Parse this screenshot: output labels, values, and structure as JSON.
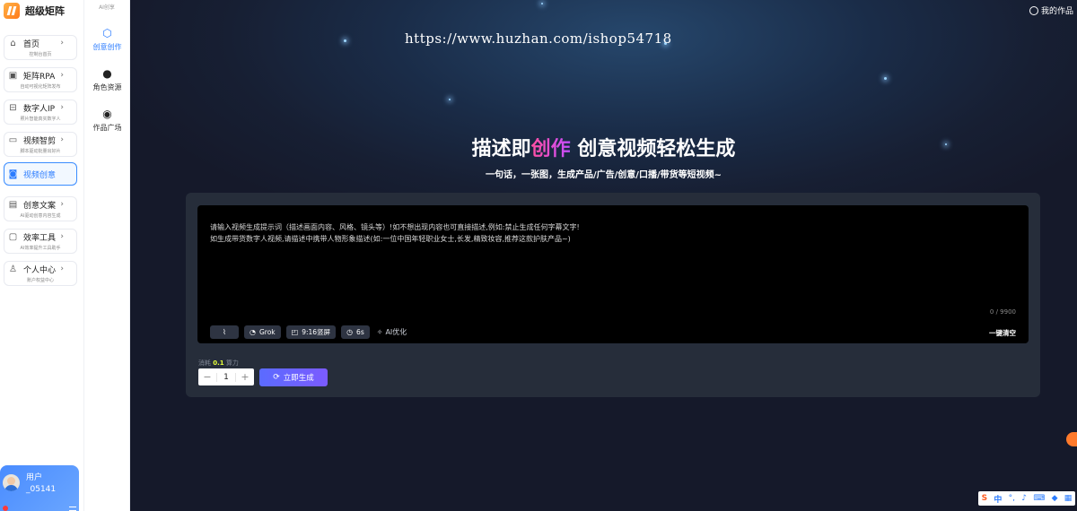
{
  "brand": {
    "name": "超级矩阵",
    "icon": "brand-logo-icon",
    "color": "#ff8a2b"
  },
  "sidebar": {
    "items": [
      {
        "label": "首页",
        "sub": "控制台首页",
        "icon": "home-icon"
      },
      {
        "label": "矩阵RPA",
        "sub": "自动可视化矩阵发布",
        "icon": "calendar-icon"
      },
      {
        "label": "数字人IP",
        "sub": "照片智能真实数字人",
        "icon": "lock-icon"
      },
      {
        "label": "视频智剪",
        "sub": "脚本驱动批量出好片",
        "icon": "video-icon"
      },
      {
        "label": "视频创意",
        "sub": "",
        "icon": "camera-icon",
        "active": true
      },
      {
        "label": "创意文案",
        "sub": "AI驱动创意内容生成",
        "icon": "monitor-icon"
      },
      {
        "label": "效率工具",
        "sub": "AI效率提升工具助手",
        "icon": "briefcase-icon"
      },
      {
        "label": "个人中心",
        "sub": "账户权益中心",
        "icon": "user-icon"
      }
    ]
  },
  "user": {
    "label": "用户",
    "id": "_05141"
  },
  "subnav": {
    "header": "AI创享",
    "items": [
      {
        "label": "创意创作",
        "icon": "creative-icon",
        "active": true
      },
      {
        "label": "角色资源",
        "icon": "people-icon"
      },
      {
        "label": "作品广场",
        "icon": "bulb-icon"
      }
    ]
  },
  "topbar": {
    "works_label": "我的作品"
  },
  "watermark": "https://www.huzhan.com/ishop54718",
  "hero": {
    "title_pre": "描述即",
    "title_highlight": "创作",
    "title_post": " 创意视频轻松生成",
    "subtitle": "一句话，一张图，生成产品/广告/创意/口播/带货等短视频~",
    "highlight_color": "#ff4fa3"
  },
  "editor": {
    "placeholder": "请输入视频生成提示词（描述画面内容、风格、镜头等）!如不想出现内容也可直接描述,例如:禁止生成任何字幕文字!\n如生成带货数字人视频,请描述中携带人物形象描述(如:一位中国年轻职业女士,长发,精致妆容,推荐这款护肤产品~)",
    "counter": "0 / 9900",
    "model": "Grok",
    "ratio": "9:16竖屏",
    "duration": "6s",
    "ai_optimize": "AI优化",
    "clear_label": "一键清空"
  },
  "cost": {
    "prefix": "消耗",
    "value": "0.1",
    "unit": "算力"
  },
  "quantity": {
    "minus": "−",
    "value": "1",
    "plus": "+"
  },
  "generate_label": "立即生成",
  "ime": {
    "brand": "S",
    "lang": "中"
  }
}
